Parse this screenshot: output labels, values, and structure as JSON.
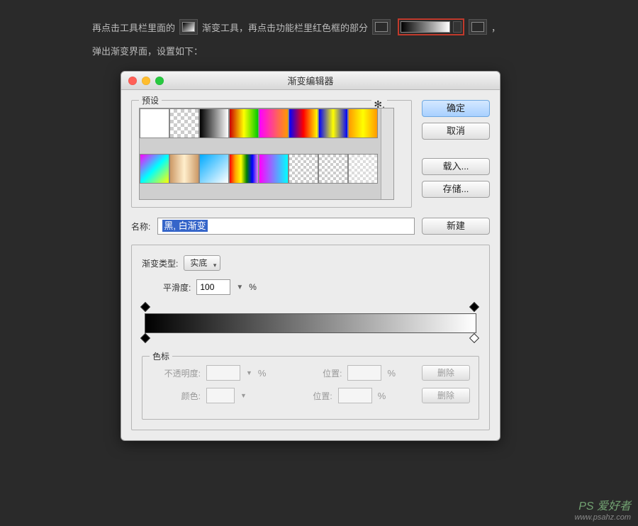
{
  "instructions": {
    "line1a": "再点击工具栏里面的",
    "line1b": "渐变工具，再点击功能栏里红色框的部分",
    "line1c": "，",
    "line2": "弹出渐变界面，设置如下："
  },
  "dialog": {
    "title": "渐变编辑器",
    "presets_label": "预设",
    "buttons": {
      "ok": "确定",
      "cancel": "取消",
      "load": "载入...",
      "save": "存储...",
      "new": "新建"
    },
    "name_label": "名称:",
    "name_value": "黑, 白渐变",
    "gradient_type_label": "渐变类型:",
    "gradient_type_value": "实底",
    "smoothness_label": "平滑度:",
    "smoothness_value": "100",
    "smoothness_unit": "%",
    "stops": {
      "group_label": "色标",
      "opacity_label": "不透明度:",
      "opacity_unit": "%",
      "location_label": "位置:",
      "location_unit": "%",
      "color_label": "颜色:",
      "delete": "删除"
    }
  },
  "presets": [
    "linear-gradient(90deg,#fff,#fff)",
    "repeating-conic-gradient(#ccc 0 25%,#fff 0 50%) 0 0/10px 10px",
    "linear-gradient(90deg,#000,#fff)",
    "linear-gradient(90deg,#c00,#ff0,#0c0)",
    "linear-gradient(90deg,#f0f,#f90)",
    "linear-gradient(90deg,#00f,#f00,#ff0)",
    "linear-gradient(90deg,#00f,#ff0,#00f)",
    "linear-gradient(90deg,#f90,#ff0,#f90)",
    "linear-gradient(135deg,#f0f,#0ff,#ff0)",
    "linear-gradient(90deg,#c96,#fec,#c96)",
    "linear-gradient(135deg,#0af,#fff)",
    "linear-gradient(90deg,red,orange,yellow,green,blue,violet)",
    "linear-gradient(90deg,#f0f,#0ff)",
    "repeating-conic-gradient(#ccc 0 25%,#fff 0 50%) 0 0/8px 8px,linear-gradient(90deg,#fff,#eee)",
    "repeating-conic-gradient(#ccc 0 25%,#fff 0 50%) 0 0/8px 8px",
    "repeating-conic-gradient(#ddd 0 25%,#fff 0 50%) 0 0/8px 8px"
  ],
  "watermark": {
    "brand": "PS 爱好者",
    "url": "www.psahz.com"
  }
}
